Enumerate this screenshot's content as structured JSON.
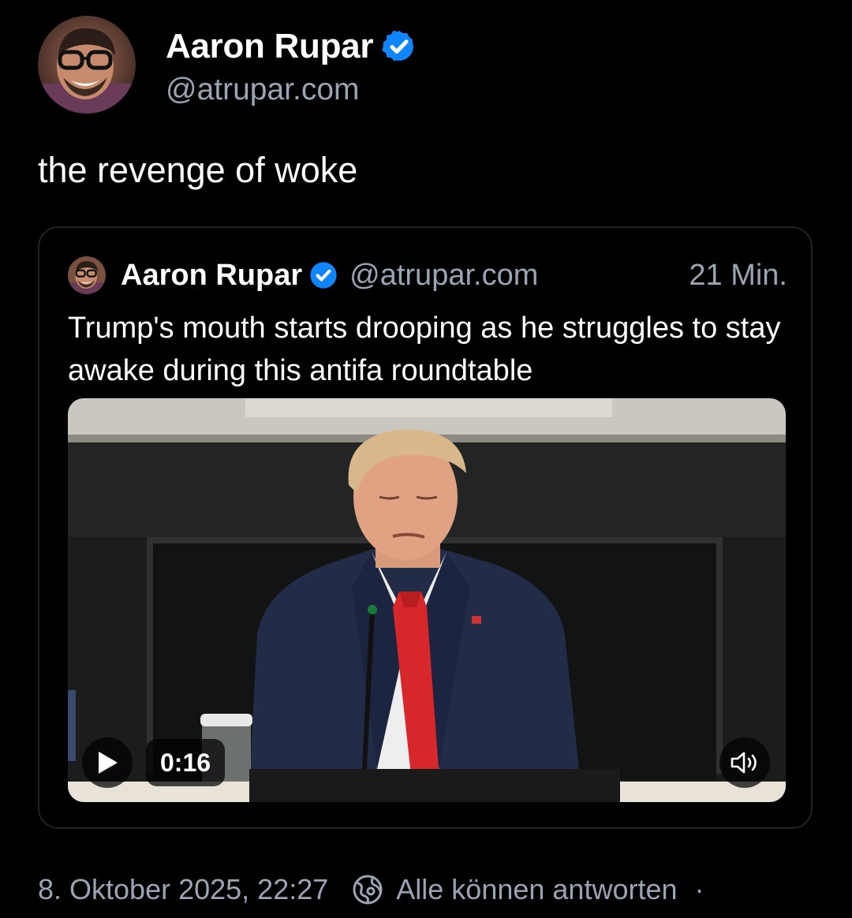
{
  "author": {
    "name": "Aaron Rupar",
    "handle": "@atrupar.com",
    "avatar_icon": "profile-photo",
    "verified_icon": "verified-badge-icon"
  },
  "post": {
    "text": "the revenge of woke"
  },
  "quoted_post": {
    "author_name": "Aaron Rupar",
    "author_handle": "@atrupar.com",
    "time": "21 Min.",
    "text": "Trump's mouth starts drooping as he struggles to stay awake during this antifa roundtable",
    "video": {
      "duration": "0:16",
      "play_icon": "play-icon",
      "mute_icon": "speaker-icon"
    }
  },
  "footer": {
    "timestamp": "8. Oktober 2025, 22:27",
    "reply_setting": "Alle können antworten",
    "separator": "·"
  },
  "colors": {
    "background": "#000000",
    "text_primary": "#ffffff",
    "text_secondary": "#9ba4b2",
    "verified": "#1185fe",
    "card_border": "#1f2428"
  }
}
